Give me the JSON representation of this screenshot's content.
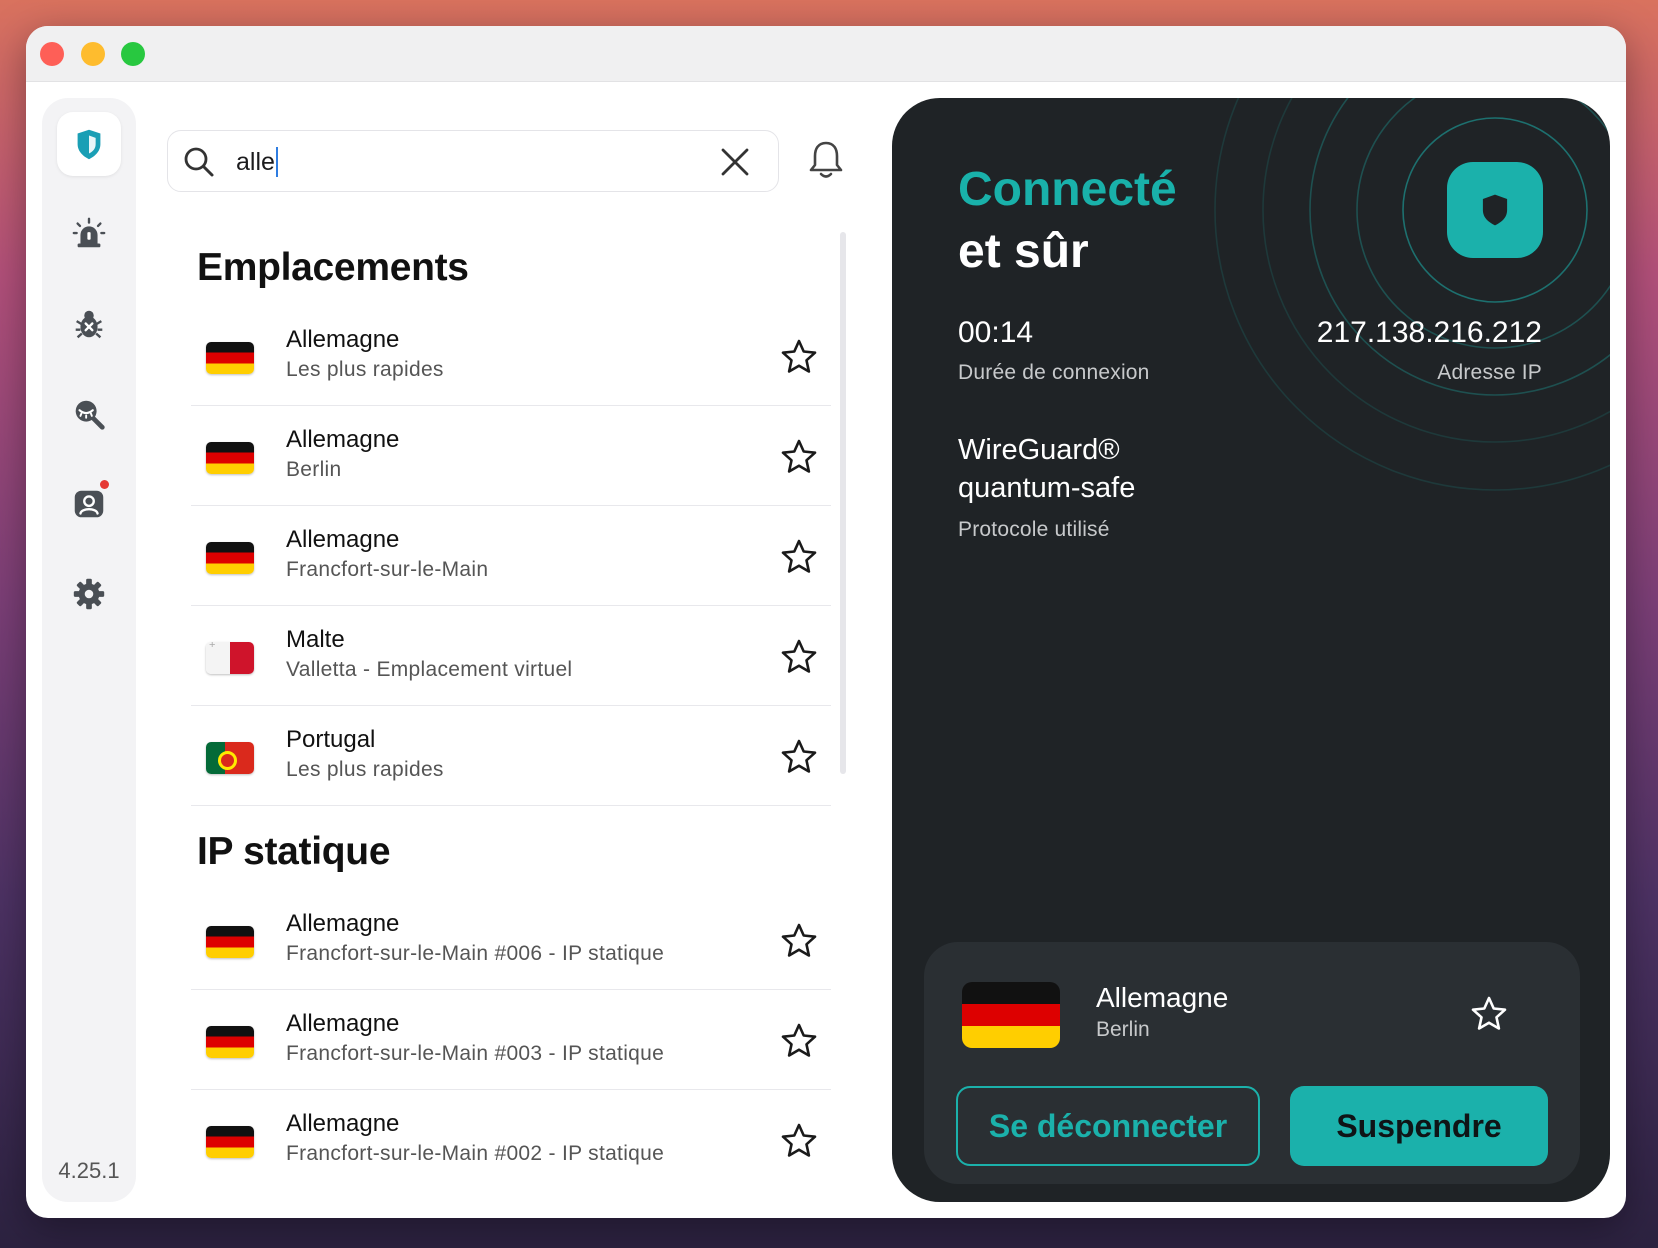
{
  "app": {
    "version": "4.25.1"
  },
  "search": {
    "value": "alle"
  },
  "sidebar": {
    "items": [
      {
        "icon": "vpn-shield-icon",
        "active": true
      },
      {
        "icon": "alert-siren-icon"
      },
      {
        "icon": "virus-bug-icon"
      },
      {
        "icon": "dark-web-search-icon"
      },
      {
        "icon": "account-icon",
        "badge": true
      },
      {
        "icon": "gear-icon"
      }
    ]
  },
  "sections": [
    {
      "title": "Emplacements",
      "items": [
        {
          "country": "Allemagne",
          "detail": "Les plus rapides",
          "flag": "de"
        },
        {
          "country": "Allemagne",
          "detail": "Berlin",
          "flag": "de"
        },
        {
          "country": "Allemagne",
          "detail": "Francfort-sur-le-Main",
          "flag": "de"
        },
        {
          "country": "Malte",
          "detail": "Valletta - Emplacement virtuel",
          "flag": "mt"
        },
        {
          "country": "Portugal",
          "detail": "Les plus rapides",
          "flag": "pt"
        }
      ]
    },
    {
      "title": "IP statique",
      "items": [
        {
          "country": "Allemagne",
          "detail": "Francfort-sur-le-Main #006 - IP statique",
          "flag": "de"
        },
        {
          "country": "Allemagne",
          "detail": "Francfort-sur-le-Main #003 - IP statique",
          "flag": "de"
        },
        {
          "country": "Allemagne",
          "detail": "Francfort-sur-le-Main #002 - IP statique",
          "flag": "de"
        }
      ]
    }
  ],
  "status": {
    "title_line1": "Connecté",
    "title_line2": "et sûr",
    "duration": "00:14",
    "duration_label": "Durée de connexion",
    "ip": "217.138.216.212",
    "ip_label": "Adresse IP",
    "protocol_line1": "WireGuard®",
    "protocol_line2": "quantum-safe",
    "protocol_label": "Protocole utilisé"
  },
  "current": {
    "country": "Allemagne",
    "city": "Berlin",
    "disconnect_label": "Se déconnecter",
    "pause_label": "Suspendre"
  },
  "colors": {
    "accent": "#1bb1ab",
    "panel": "#1f2326",
    "card": "#2a2f33"
  }
}
